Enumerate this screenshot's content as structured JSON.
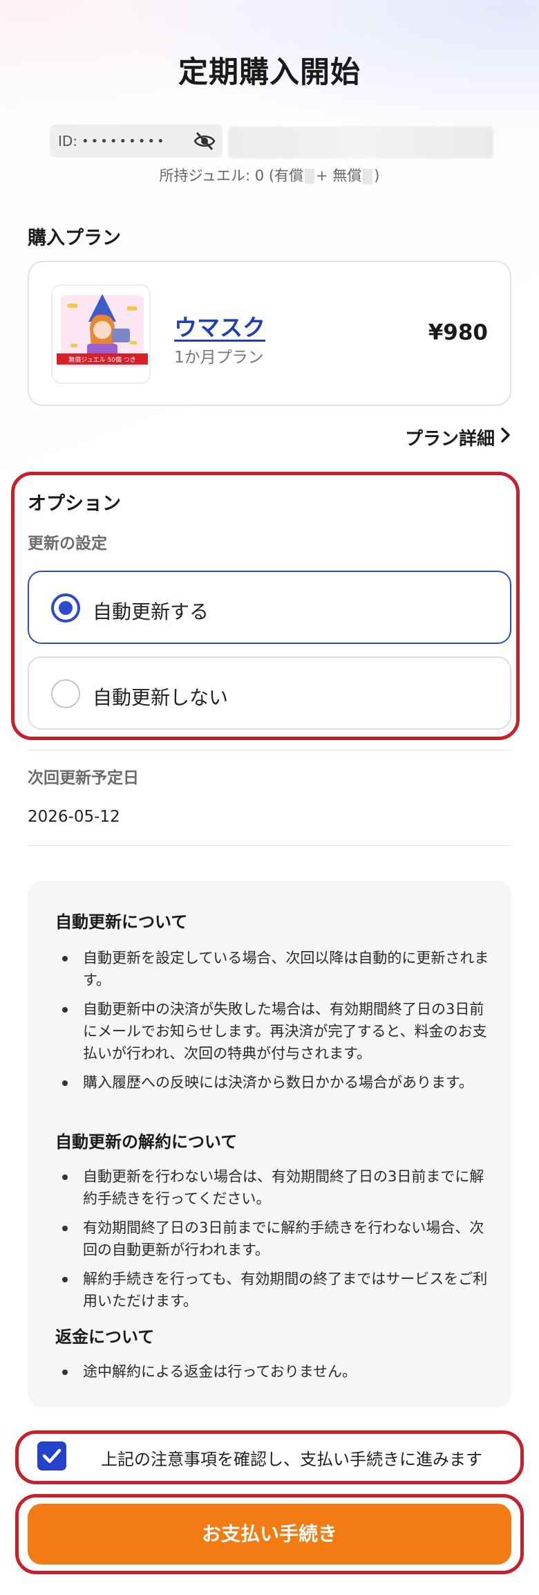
{
  "header": {
    "title": "定期購入開始"
  },
  "account": {
    "id_label": "ID:",
    "id_masked": "•••••••••",
    "jewel_prefix": "所持ジュエル: 0 (有償",
    "jewel_mid": "+ 無償",
    "jewel_suffix": ")"
  },
  "plan": {
    "section_label": "購入プラン",
    "name": "ウマスク",
    "period": "1か月プラン",
    "price": "¥980",
    "thumb_badge": "無償ジュエル 50個 つき",
    "detail_link": "プラン詳細"
  },
  "options": {
    "title": "オプション",
    "renewal_label": "更新の設定",
    "choices": [
      {
        "label": "自動更新する",
        "selected": true
      },
      {
        "label": "自動更新しない",
        "selected": false
      }
    ]
  },
  "next_renewal": {
    "label": "次回更新予定日",
    "date": "2026-05-12"
  },
  "notices": {
    "auto_heading": "自動更新について",
    "auto_items": [
      "自動更新を設定している場合、次回以降は自動的に更新されます。",
      "自動更新中の決済が失敗した場合は、有効期間終了日の3日前にメールでお知らせします。再決済が完了すると、料金のお支払いが行われ、次回の特典が付与されます。",
      "購入履歴への反映には決済から数日かかる場合があります。"
    ],
    "cancel_heading": "自動更新の解約について",
    "cancel_items": [
      "自動更新を行わない場合は、有効期間終了日の3日前までに解約手続きを行ってください。",
      "有効期間終了日の3日前までに解約手続きを行わない場合、次回の自動更新が行われます。",
      "解約手続きを行っても、有効期間の終了まではサービスをご利用いただけます。"
    ],
    "refund_heading": "返金について",
    "refund_items": [
      "途中解約による返金は行っておりません。"
    ]
  },
  "agreement": {
    "label": "上記の注意事項を確認し、支払い手続きに進みます",
    "checked": true
  },
  "pay_button": {
    "label": "お支払い手続き"
  },
  "colors": {
    "accent_blue": "#2a4ad0",
    "highlight_red": "#c8202a",
    "pay_orange": "#f27b13"
  }
}
